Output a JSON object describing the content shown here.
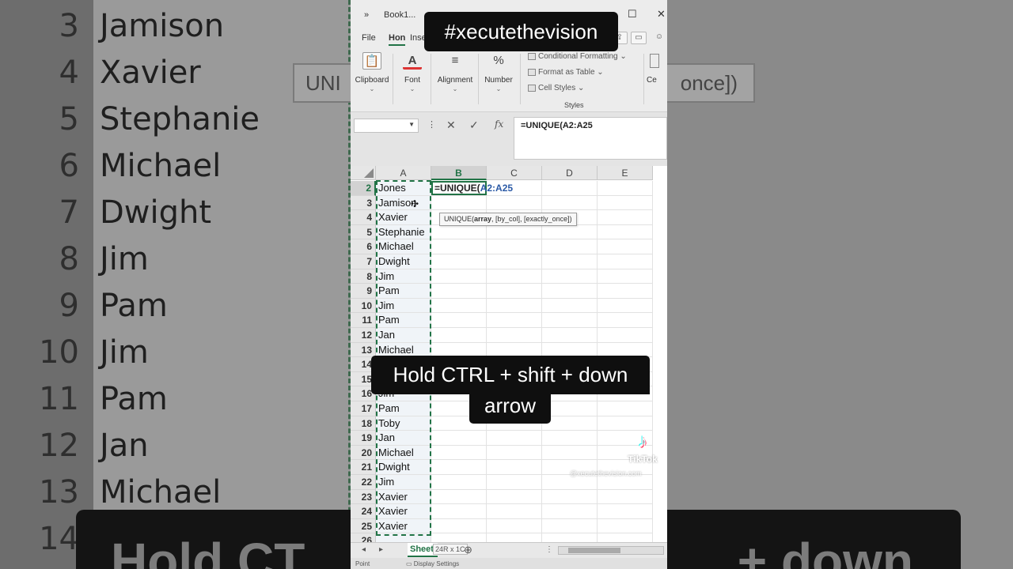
{
  "background": {
    "rows": [
      {
        "num": "3",
        "name": "Jamison"
      },
      {
        "num": "4",
        "name": "Xavier"
      },
      {
        "num": "5",
        "name": "Stephanie"
      },
      {
        "num": "6",
        "name": "Michael"
      },
      {
        "num": "7",
        "name": "Dwight"
      },
      {
        "num": "8",
        "name": "Jim"
      },
      {
        "num": "9",
        "name": "Pam"
      },
      {
        "num": "10",
        "name": "Jim"
      },
      {
        "num": "11",
        "name": "Pam"
      },
      {
        "num": "12",
        "name": "Jan"
      },
      {
        "num": "13",
        "name": "Michael"
      },
      {
        "num": "14",
        "name": ""
      }
    ],
    "tooltip_left": "UNI",
    "tooltip_right": "once])",
    "caption_left": "Hold CT",
    "caption_right": "+ down"
  },
  "window": {
    "title": "Book1...",
    "chevron": "»"
  },
  "ribbon": {
    "tabs": [
      "File",
      "Hon",
      "Inse"
    ],
    "groups": [
      {
        "label": "Clipboard",
        "icon": "clipboard-icon"
      },
      {
        "label": "Font",
        "icon": "font-color-icon"
      },
      {
        "label": "Alignment",
        "icon": "align-icon"
      },
      {
        "label": "Number",
        "icon": "percent-icon"
      }
    ],
    "styles": {
      "conditional": "Conditional Formatting",
      "format_table": "Format as Table",
      "cell_styles": "Cell Styles",
      "label": "Styles"
    },
    "cells_group_label": "Ce"
  },
  "formula_bar": {
    "namebox": "",
    "cancel": "✕",
    "enter": "✓",
    "fx": "fx",
    "value": "=UNIQUE(A2:A25"
  },
  "grid": {
    "columns": [
      "A",
      "B",
      "C",
      "D",
      "E"
    ],
    "rows": [
      {
        "num": "2",
        "a": "Jones"
      },
      {
        "num": "3",
        "a": "Jamison"
      },
      {
        "num": "4",
        "a": "Xavier"
      },
      {
        "num": "5",
        "a": "Stephanie"
      },
      {
        "num": "6",
        "a": "Michael"
      },
      {
        "num": "7",
        "a": "Dwight"
      },
      {
        "num": "8",
        "a": "Jim"
      },
      {
        "num": "9",
        "a": "Pam"
      },
      {
        "num": "10",
        "a": "Jim"
      },
      {
        "num": "11",
        "a": "Pam"
      },
      {
        "num": "12",
        "a": "Jan"
      },
      {
        "num": "13",
        "a": "Michael"
      },
      {
        "num": "14",
        "a": ""
      },
      {
        "num": "15",
        "a": ""
      },
      {
        "num": "16",
        "a": "Jim"
      },
      {
        "num": "17",
        "a": "Pam"
      },
      {
        "num": "18",
        "a": "Toby"
      },
      {
        "num": "19",
        "a": "Jan"
      },
      {
        "num": "20",
        "a": "Michael"
      },
      {
        "num": "21",
        "a": "Dwight"
      },
      {
        "num": "22",
        "a": "Jim"
      },
      {
        "num": "23",
        "a": "Xavier"
      },
      {
        "num": "24",
        "a": "Xavier"
      },
      {
        "num": "25",
        "a": "Xavier"
      },
      {
        "num": "26",
        "a": ""
      }
    ],
    "active_cell_prefix": "=UNIQUE(",
    "active_cell_ref": "A2:A25",
    "tooltip": {
      "fn": "UNIQUE(",
      "bold_arg": "array",
      "rest": ", [by_col], [exactly_once])"
    }
  },
  "sheet_bar": {
    "tab": "Sheet",
    "selection_size": "24R x 1C",
    "add": "⊕"
  },
  "status_bar": {
    "mode": "Point",
    "display_settings": "Display Settings"
  },
  "overlay": {
    "hashtag": "#xecutethevision",
    "caption_line1": "Hold CTRL + shift + down",
    "caption_line2": "arrow",
    "tiktok": "TikTok",
    "tiktok_user": "@xecutethevision.com"
  }
}
